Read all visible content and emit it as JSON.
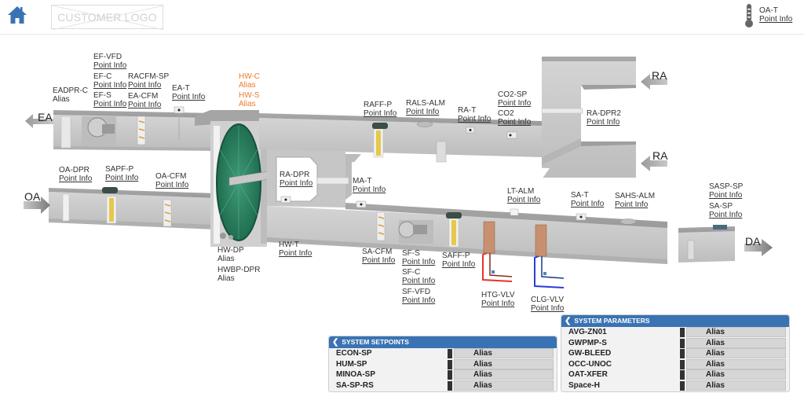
{
  "header": {
    "home_icon": "home-icon",
    "logo_text": "CUSTOMER LOGO",
    "oat": {
      "name": "OA-T",
      "link": "Point Info",
      "icon": "thermometer-icon"
    }
  },
  "colors": {
    "accent": "#3a73b3",
    "orange_label": "#ee7d2c",
    "duct": "#c8c8c8",
    "wheel": "#2e8b6a",
    "heating_pipe": "#e8332a",
    "cooling_pipe": "#2a3fd6"
  },
  "airflow": {
    "ea": "EA",
    "oa": "OA",
    "ra_top": "RA",
    "ra_bottom": "RA",
    "da": "DA"
  },
  "points": [
    {
      "id": "ef-vfd",
      "name": "EF-VFD",
      "link": "Point Info"
    },
    {
      "id": "ef-c",
      "name": "EF-C",
      "link": "Point Info"
    },
    {
      "id": "ef-s",
      "name": "EF-S",
      "link": "Point Info"
    },
    {
      "id": "racfm-sp",
      "name": "RACFM-SP",
      "link": "Point Info"
    },
    {
      "id": "ea-cfm",
      "name": "EA-CFM",
      "link": "Point Info"
    },
    {
      "id": "ea-t",
      "name": "EA-T",
      "link": "Point Info"
    },
    {
      "id": "eadpr-c",
      "name": "EADPR-C",
      "link": "Alias"
    },
    {
      "id": "hw-c",
      "name": "HW-C",
      "link": "Alias"
    },
    {
      "id": "hw-s",
      "name": "HW-S",
      "link": "Alias"
    },
    {
      "id": "raff-p",
      "name": "RAFF-P",
      "link": "Point Info"
    },
    {
      "id": "rals-alm",
      "name": "RALS-ALM",
      "link": "Point Info"
    },
    {
      "id": "ra-t",
      "name": "RA-T",
      "link": "Point Info"
    },
    {
      "id": "co2-sp",
      "name": "CO2-SP",
      "link": "Point Info"
    },
    {
      "id": "co2",
      "name": "CO2",
      "link": "Point Info"
    },
    {
      "id": "ra-dpr2",
      "name": "RA-DPR2",
      "link": "Point Info"
    },
    {
      "id": "oa-dpr",
      "name": "OA-DPR",
      "link": "Point Info"
    },
    {
      "id": "sapf-p",
      "name": "SAPF-P",
      "link": "Point Info"
    },
    {
      "id": "oa-cfm",
      "name": "OA-CFM",
      "link": "Point Info"
    },
    {
      "id": "ra-dpr",
      "name": "RA-DPR",
      "link": "Point Info"
    },
    {
      "id": "ma-t",
      "name": "MA-T",
      "link": "Point Info"
    },
    {
      "id": "lt-alm",
      "name": "LT-ALM",
      "link": "Point Info"
    },
    {
      "id": "sa-t",
      "name": "SA-T",
      "link": "Point Info"
    },
    {
      "id": "sahs-alm",
      "name": "SAHS-ALM",
      "link": "Point Info"
    },
    {
      "id": "sasp-sp",
      "name": "SASP-SP",
      "link": "Point Info"
    },
    {
      "id": "sa-sp",
      "name": "SA-SP",
      "link": "Point Info"
    },
    {
      "id": "hw-dp",
      "name": "HW-DP",
      "link": "Alias"
    },
    {
      "id": "hwbp-dpr",
      "name": "HWBP-DPR",
      "link": "Alias"
    },
    {
      "id": "hw-t",
      "name": "HW-T",
      "link": "Point Info"
    },
    {
      "id": "sa-cfm",
      "name": "SA-CFM",
      "link": "Point Info"
    },
    {
      "id": "sf-s",
      "name": "SF-S",
      "link": "Point Info"
    },
    {
      "id": "sf-c",
      "name": "SF-C",
      "link": "Point Info"
    },
    {
      "id": "sf-vfd",
      "name": "SF-VFD",
      "link": "Point Info"
    },
    {
      "id": "saff-p",
      "name": "SAFF-P",
      "link": "Point Info"
    },
    {
      "id": "htg-vlv",
      "name": "HTG-VLV",
      "link": "Point Info"
    },
    {
      "id": "clg-vlv",
      "name": "CLG-VLV",
      "link": "Point Info"
    }
  ],
  "setpoints_panel": {
    "title": "SYSTEM SETPOINTS",
    "rows": [
      {
        "name": "ECON-SP",
        "value": "Alias"
      },
      {
        "name": "HUM-SP",
        "value": "Alias"
      },
      {
        "name": "MINOA-SP",
        "value": "Alias"
      },
      {
        "name": "SA-SP-RS",
        "value": "Alias"
      }
    ]
  },
  "parameters_panel": {
    "title": "SYSTEM PARAMETERS",
    "rows": [
      {
        "name": "AVG-ZN01",
        "value": "Alias"
      },
      {
        "name": "GWPMP-S",
        "value": "Alias"
      },
      {
        "name": "GW-BLEED",
        "value": "Alias"
      },
      {
        "name": "OCC-UNOC",
        "value": "Alias"
      },
      {
        "name": "OAT-XFER",
        "value": "Alias"
      },
      {
        "name": "Space-H",
        "value": "Alias"
      }
    ]
  }
}
